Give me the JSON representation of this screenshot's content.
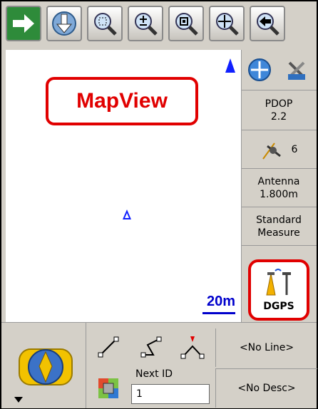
{
  "toolbar": {
    "buttons": [
      {
        "name": "forward-arrow-icon"
      },
      {
        "name": "download-arrow-icon"
      },
      {
        "name": "zoom-window-icon"
      },
      {
        "name": "zoom-in-out-icon"
      },
      {
        "name": "zoom-extent-icon"
      },
      {
        "name": "pan-icon"
      },
      {
        "name": "back-arrow-icon"
      }
    ]
  },
  "map": {
    "label": "MapView",
    "scale": "20m"
  },
  "right_panel": {
    "pdop_label": "PDOP",
    "pdop_value": "2.2",
    "satellites": "6",
    "antenna_label": "Antenna",
    "antenna_value": "1.800m",
    "mode_line1": "Standard",
    "mode_line2": "Measure",
    "dgps_label": "DGPS"
  },
  "bottom": {
    "next_id_label": "Next ID",
    "next_id_value": "1",
    "no_line": "<No Line>",
    "no_desc": "<No Desc>"
  },
  "colors": {
    "highlight": "#e10000",
    "map_marker": "#1020ff",
    "scale": "#0000cc"
  }
}
